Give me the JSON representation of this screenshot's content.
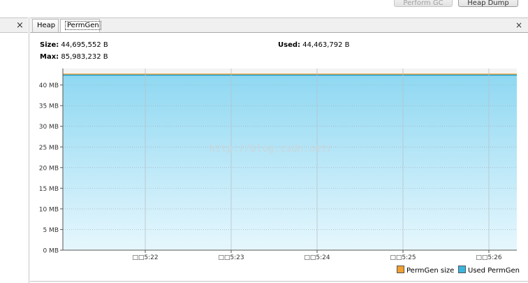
{
  "toolbar": {
    "perform_gc_label": "Perform GC",
    "heap_dump_label": "Heap Dump"
  },
  "left_panel": {
    "close_glyph": "×"
  },
  "tabs": [
    {
      "label": "Heap"
    },
    {
      "label": "PermGen"
    }
  ],
  "tabbar": {
    "close_glyph": "×"
  },
  "metrics": {
    "size_label": "Size:",
    "size_value": "44,695,552 B",
    "max_label": "Max:",
    "max_value": "85,983,232 B",
    "used_label": "Used:",
    "used_value": "44,463,792 B"
  },
  "watermark": "http://blog.csdn.net/",
  "legend": [
    {
      "name": "PermGen size",
      "color": "#f0a030"
    },
    {
      "name": "Used PermGen",
      "color": "#38b6e0"
    }
  ],
  "chart_data": {
    "type": "area",
    "y_unit": "MB",
    "yticks": [
      "0 MB",
      "5 MB",
      "10 MB",
      "15 MB",
      "20 MB",
      "25 MB",
      "30 MB",
      "35 MB",
      "40 MB"
    ],
    "ylim": [
      0,
      44
    ],
    "xticks": [
      "□□5:22",
      "□□5:23",
      "□□5:24",
      "□□5:25",
      "□□5:26"
    ],
    "grid": true,
    "legend_position": "bottom-right",
    "series": [
      {
        "name": "PermGen size",
        "color": "#f0a030",
        "value": 42.63
      },
      {
        "name": "Used PermGen",
        "color": "#38b6e0",
        "value": 42.4
      }
    ]
  }
}
